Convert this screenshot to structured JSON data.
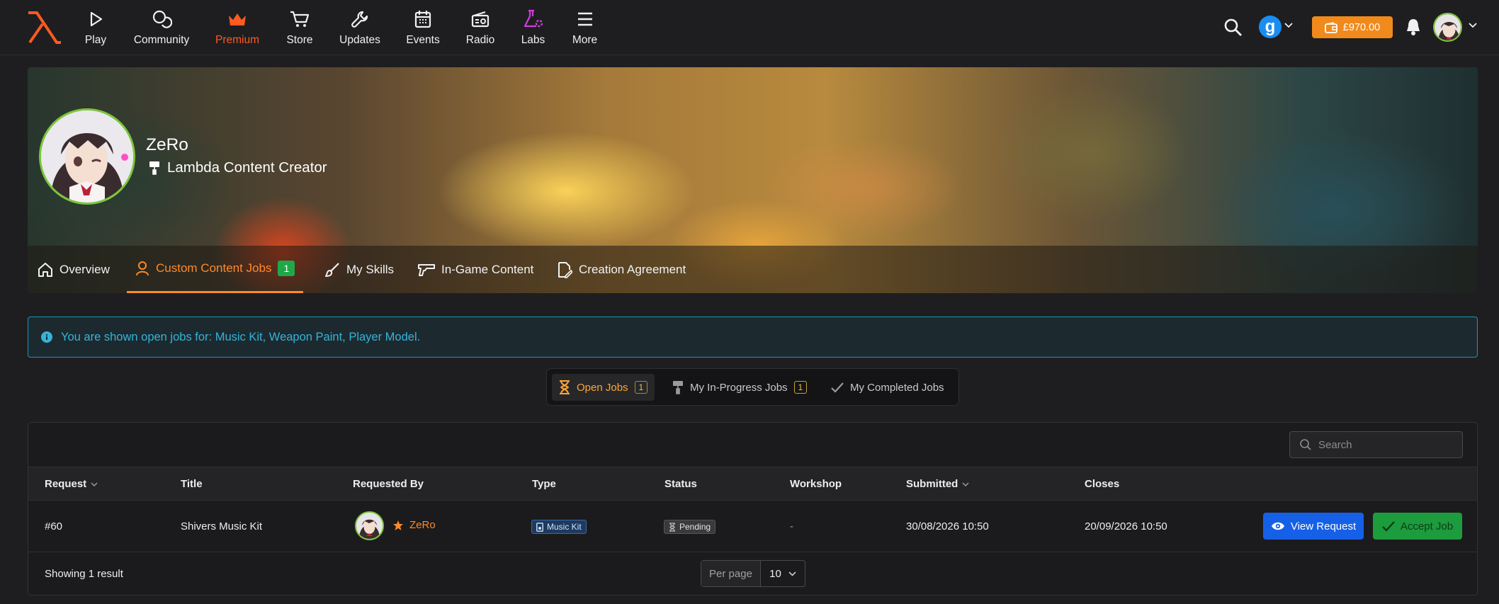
{
  "nav": {
    "items": [
      {
        "label": "Play",
        "icon": "play-icon"
      },
      {
        "label": "Community",
        "icon": "community-icon"
      },
      {
        "label": "Premium",
        "icon": "crown-icon"
      },
      {
        "label": "Store",
        "icon": "cart-icon"
      },
      {
        "label": "Updates",
        "icon": "wrench-icon"
      },
      {
        "label": "Events",
        "icon": "calendar-icon"
      },
      {
        "label": "Radio",
        "icon": "radio-icon"
      },
      {
        "label": "Labs",
        "icon": "flask-icon"
      },
      {
        "label": "More",
        "icon": "menu-icon"
      }
    ],
    "gmod_letter": "g",
    "balance": "£970.00",
    "colors": {
      "premium": "#ff5a1f",
      "labs": "#d23ce0",
      "balance": "#f08a1c",
      "logo": "#ff5a1f"
    }
  },
  "profile": {
    "name": "ZeRo",
    "role": "Lambda Content Creator",
    "tabs": [
      {
        "label": "Overview",
        "icon": "home-icon"
      },
      {
        "label": "Custom Content Jobs",
        "icon": "user-icon",
        "count": "1",
        "active": true
      },
      {
        "label": "My Skills",
        "icon": "brush-icon"
      },
      {
        "label": "In-Game Content",
        "icon": "gun-icon"
      },
      {
        "label": "Creation Agreement",
        "icon": "document-sign-icon"
      }
    ]
  },
  "alert": {
    "text": "You are shown open jobs for: Music Kit, Weapon Paint, Player Model."
  },
  "job_tabs": [
    {
      "label": "Open Jobs",
      "count": "1",
      "active": true
    },
    {
      "label": "My In-Progress Jobs",
      "count": "1"
    },
    {
      "label": "My Completed Jobs"
    }
  ],
  "table": {
    "search_placeholder": "Search",
    "columns": [
      "Request",
      "Title",
      "Requested By",
      "Type",
      "Status",
      "Workshop",
      "Submitted",
      "Closes"
    ],
    "rows": [
      {
        "request": "#60",
        "title": "Shivers Music Kit",
        "requested_by": "ZeRo",
        "type": "Music Kit",
        "status": "Pending",
        "workshop": "-",
        "submitted": "30/08/2026 10:50",
        "closes": "20/09/2026 10:50",
        "view_label": "View Request",
        "accept_label": "Accept Job"
      }
    ],
    "footer": "Showing 1 result",
    "per_page_label": "Per page",
    "per_page_value": "10"
  }
}
